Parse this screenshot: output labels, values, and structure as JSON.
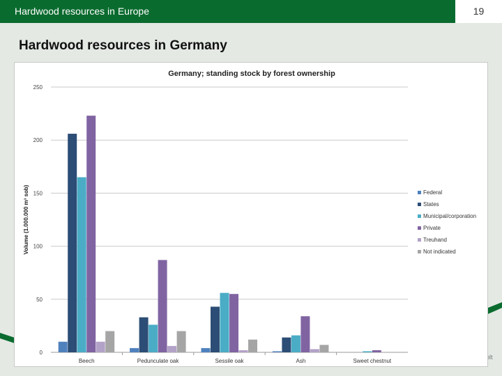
{
  "header": {
    "title": "Hardwood resources in Europe",
    "page_number": "19"
  },
  "slide": {
    "title": "Hardwood resources in Germany",
    "footer_fragment": "olt"
  },
  "colors": {
    "header_bg": "#0a6b2f",
    "page_bg": "#e4e9e4"
  },
  "chart_data": {
    "type": "bar",
    "title": "Germany; standing stock by forest ownership",
    "ylabel": "Volume (1.000.000 m³ sob)",
    "xlabel": "",
    "ylim": [
      0,
      250
    ],
    "yticks": [
      0,
      50,
      100,
      150,
      200,
      250
    ],
    "grid": true,
    "legend_position": "right",
    "categories": [
      "Beech",
      "Pedunculate oak",
      "Sessile oak",
      "Ash",
      "Sweet chestnut"
    ],
    "series": [
      {
        "name": "Federal",
        "color": "#4f81bd",
        "values": [
          10,
          4,
          4,
          1,
          0
        ]
      },
      {
        "name": "States",
        "color": "#2c4d75",
        "values": [
          206,
          33,
          43,
          14,
          0
        ]
      },
      {
        "name": "Municipal/corporation",
        "color": "#4bacc6",
        "values": [
          165,
          26,
          56,
          16,
          1
        ]
      },
      {
        "name": "Private",
        "color": "#8064a2",
        "values": [
          223,
          87,
          55,
          34,
          2
        ]
      },
      {
        "name": "Treuhand",
        "color": "#b3a2c7",
        "values": [
          10,
          6,
          2,
          3,
          0
        ]
      },
      {
        "name": "Not indicated",
        "color": "#a5a5a5",
        "values": [
          20,
          20,
          12,
          7,
          0
        ]
      }
    ]
  }
}
